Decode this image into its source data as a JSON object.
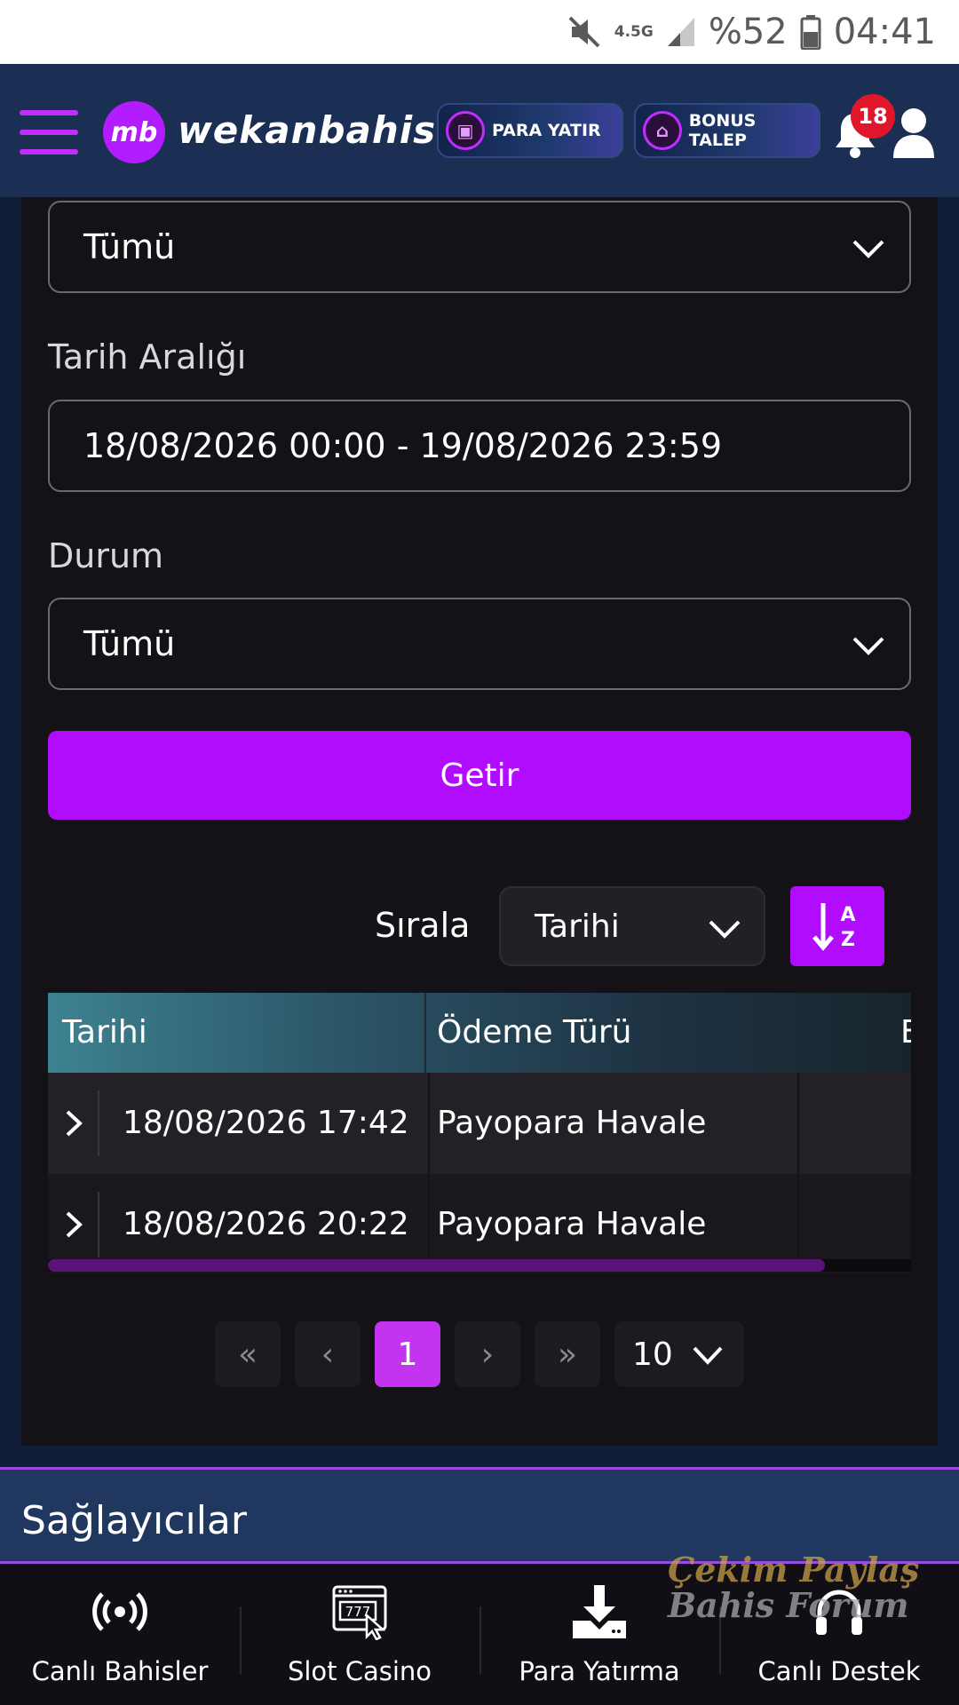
{
  "status_bar": {
    "network": "4.5G",
    "battery": "%52",
    "time": "04:41",
    "icons": [
      "mute-icon",
      "signal-icon",
      "battery-icon"
    ]
  },
  "header": {
    "logo_mark": "mb",
    "logo_text": "wekanbahis",
    "deposit_label": "PARA YATIR",
    "bonus_label": "BONUS TALEP",
    "notification_count": "18"
  },
  "filters": {
    "type_select": "Tümü",
    "date_range_label": "Tarih Aralığı",
    "date_range_value": "18/08/2026 00:00 - 19/08/2026 23:59",
    "status_label": "Durum",
    "status_select": "Tümü",
    "submit_label": "Getir"
  },
  "sort": {
    "label": "Sırala",
    "selected": "Tarihi",
    "direction_icon": "sort-az-icon"
  },
  "table": {
    "columns": [
      "Tarihi",
      "Ödeme Türü",
      "E"
    ],
    "rows": [
      {
        "date": "18/08/2026 17:42",
        "method": "Payopara Havale"
      },
      {
        "date": "18/08/2026 20:22",
        "method": "Payopara Havale"
      }
    ],
    "scroll_position_fraction": 0.9
  },
  "pagination": {
    "first": "«",
    "prev": "‹",
    "current": "1",
    "next": "›",
    "last": "»",
    "page_size": "10"
  },
  "providers": {
    "title": "Sağlayıcılar"
  },
  "bottom_nav": [
    {
      "label": "Canlı Bahisler",
      "icon": "live-broadcast-icon"
    },
    {
      "label": "Slot Casino",
      "icon": "slot-machine-icon"
    },
    {
      "label": "Para Yatırma",
      "icon": "download-deposit-icon"
    },
    {
      "label": "Canlı Destek",
      "icon": "headset-icon"
    }
  ],
  "watermark": {
    "line1": "Çekim Paylaş",
    "line2": "Bahis Forum"
  },
  "colors": {
    "accent": "#b20cff",
    "header_bg": "#1b2f55",
    "panel_bg": "#141117",
    "badge": "#e0172b"
  }
}
